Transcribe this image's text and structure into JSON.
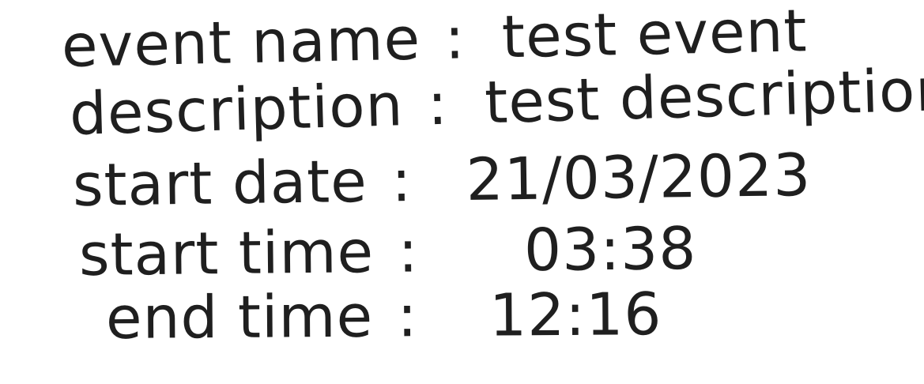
{
  "note": {
    "lines": [
      {
        "label": "event name",
        "value": "test event"
      },
      {
        "label": "description",
        "value": "test description"
      },
      {
        "label": "start date",
        "value": "21/03/2023"
      },
      {
        "label": "start time",
        "value": "03:38"
      },
      {
        "label": "end time",
        "value": "12:16"
      }
    ],
    "colon": ":"
  }
}
